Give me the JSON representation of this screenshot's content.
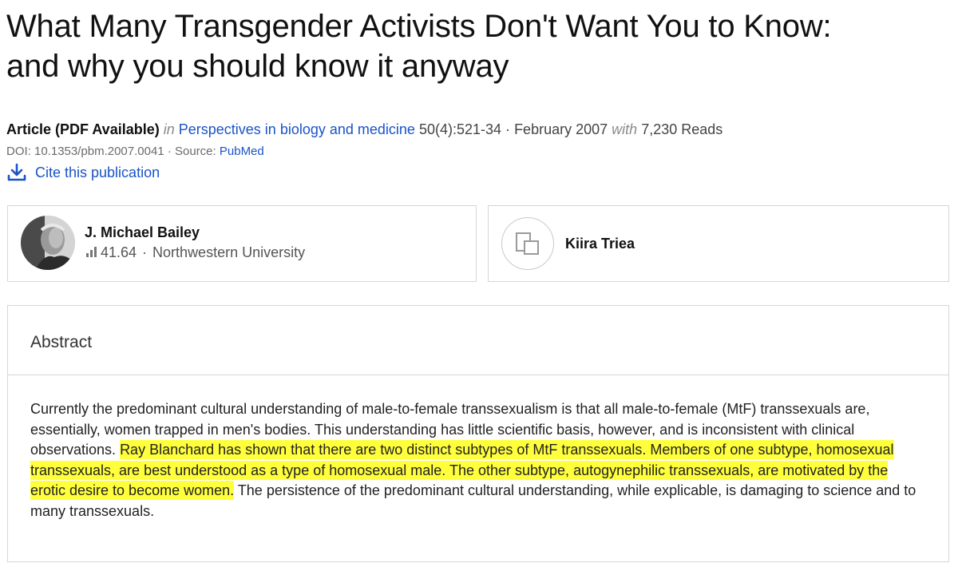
{
  "article": {
    "title_line1": "What Many Transgender Activists Don't Want You to Know:",
    "title_line2": "and why you should know it anyway",
    "type": "Article (PDF Available)",
    "in_word": "in",
    "journal": "Perspectives in biology and medicine",
    "volume": "50(4):521-34",
    "date": "February 2007",
    "with_word": "with",
    "reads": "7,230 Reads",
    "doi": "DOI: 10.1353/pbm.2007.0041",
    "source_label": "Source:",
    "source": "PubMed",
    "cite_label": "Cite this publication"
  },
  "authors": [
    {
      "name": "J. Michael Bailey",
      "score": "41.64",
      "affiliation": "Northwestern University"
    },
    {
      "name": "Kiira Triea"
    }
  ],
  "abstract": {
    "heading": "Abstract",
    "text_before": "Currently the predominant cultural understanding of male-to-female transsexualism is that all male-to-female (MtF) transsexuals are, essentially, women trapped in men's bodies. This understanding has little scientific basis, however, and is inconsistent with clinical observations. ",
    "text_highlight": "Ray Blanchard has shown that there are two distinct subtypes of MtF transsexuals. Members of one subtype, homosexual transsexuals, are best understood as a type of homosexual male. The other subtype, autogynephilic transsexuals, are motivated by the erotic desire to become women.",
    "text_after": " The persistence of the predominant cultural understanding, while explicable, is damaging to science and to many transsexuals."
  },
  "colors": {
    "link": "#1a53c8",
    "highlight": "#ffff3c",
    "border": "#d6d6d6"
  },
  "icons": {
    "cite": "download-icon",
    "score": "bar-chart-icon",
    "placeholder": "author-placeholder-icon"
  }
}
